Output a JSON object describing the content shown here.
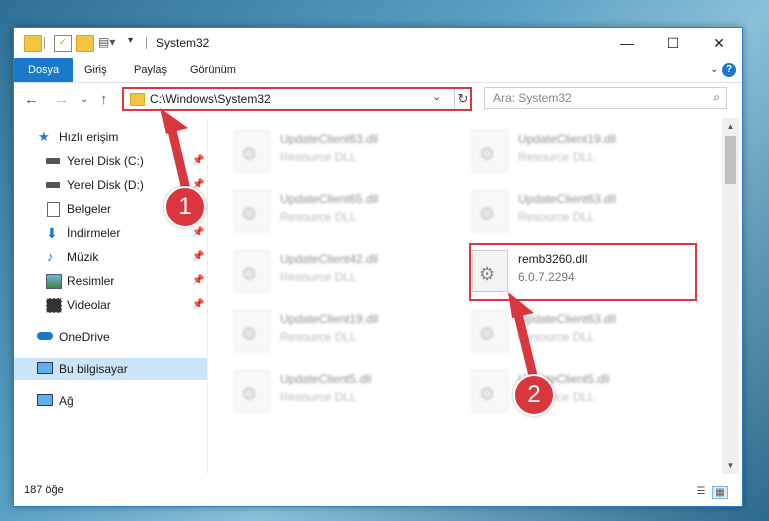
{
  "window": {
    "title": "System32",
    "controls": {
      "minimize": "—",
      "maximize": "☐",
      "close": "✕"
    }
  },
  "ribbon": {
    "tabs": [
      "Dosya",
      "Giriş",
      "Paylaş",
      "Görünüm"
    ],
    "help": "?"
  },
  "address": {
    "path": "C:\\Windows\\System32",
    "search_placeholder": "Ara: System32"
  },
  "sidebar": {
    "items": [
      {
        "label": "Hızlı erişim",
        "icon": "star-icon",
        "pinned": false
      },
      {
        "label": "Yerel Disk (C:)",
        "icon": "drive-icon",
        "pinned": true
      },
      {
        "label": "Yerel Disk (D:)",
        "icon": "drive-icon",
        "pinned": true
      },
      {
        "label": "Belgeler",
        "icon": "document-icon",
        "pinned": true
      },
      {
        "label": "İndirmeler",
        "icon": "download-icon",
        "pinned": true
      },
      {
        "label": "Müzik",
        "icon": "music-icon",
        "pinned": true
      },
      {
        "label": "Resimler",
        "icon": "pictures-icon",
        "pinned": true
      },
      {
        "label": "Videolar",
        "icon": "video-icon",
        "pinned": true
      },
      {
        "label": "OneDrive",
        "icon": "cloud-icon",
        "pinned": false
      },
      {
        "label": "Bu bilgisayar",
        "icon": "computer-icon",
        "pinned": false,
        "selected": true
      },
      {
        "label": "Ağ",
        "icon": "network-icon",
        "pinned": false
      }
    ]
  },
  "files": [
    {
      "name": "UpdateClient63.dll",
      "desc": "Resource DLL",
      "blurred": true
    },
    {
      "name": "UpdateClient19.dll",
      "desc": "Resource DLL",
      "blurred": true
    },
    {
      "name": "UpdateClient65.dll",
      "desc": "Resource DLL",
      "blurred": true
    },
    {
      "name": "UpdateClient63.dll",
      "desc": "Resource DLL",
      "blurred": true
    },
    {
      "name": "UpdateClient42.dll",
      "desc": "Resource DLL",
      "blurred": true
    },
    {
      "name": "remb3260.dll",
      "desc": "6.0.7.2294",
      "blurred": false
    },
    {
      "name": "UpdateClient19.dll",
      "desc": "Resource DLL",
      "blurred": true
    },
    {
      "name": "UpdateClient63.dll",
      "desc": "Resource DLL",
      "blurred": true
    },
    {
      "name": "UpdateClient5.dll",
      "desc": "Resource DLL",
      "blurred": true
    },
    {
      "name": "UpdateClient5.dll",
      "desc": "Resource DLL",
      "blurred": true
    }
  ],
  "status": {
    "count": "187 öğe"
  },
  "annotations": {
    "step1": "1",
    "step2": "2",
    "color": "#d9363e"
  }
}
